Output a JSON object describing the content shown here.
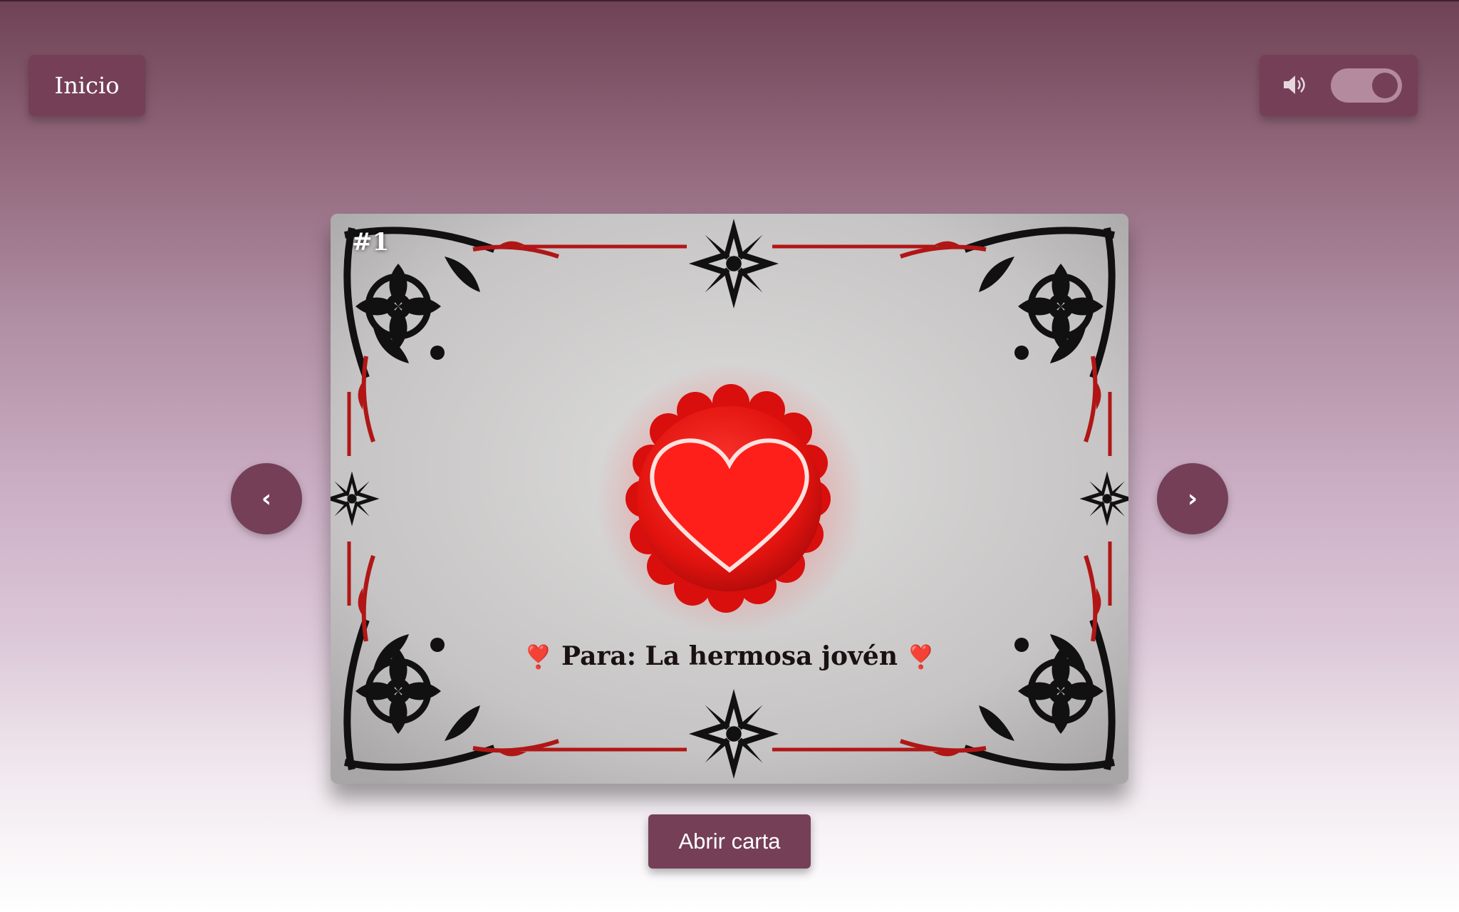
{
  "header": {
    "home_label": "Inicio",
    "sound": {
      "icon": "speaker-icon",
      "enabled": true
    }
  },
  "carousel": {
    "prev_label": "‹",
    "next_label": "›",
    "card": {
      "number": "#1",
      "caption": "Para: La hermosa jovén",
      "caption_emoji": "❣️"
    }
  },
  "actions": {
    "open_label": "Abrir carta"
  },
  "colors": {
    "accent": "#753f58",
    "heart": "#e8232e"
  }
}
